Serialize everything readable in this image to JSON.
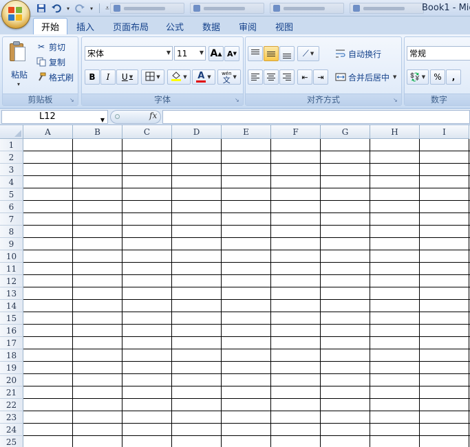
{
  "title_bar": {
    "window_title": "Book1 - Mic",
    "qat": {
      "save_icon": "save-icon",
      "undo_icon": "undo-icon",
      "redo_icon": "redo-icon",
      "customize_icon": "customize-qat-icon"
    }
  },
  "ribbon_tabs": [
    "开始",
    "插入",
    "页面布局",
    "公式",
    "数据",
    "审阅",
    "视图"
  ],
  "active_tab": "开始",
  "clipboard": {
    "group_label": "剪贴板",
    "paste_label": "粘贴",
    "cut_label": "剪切",
    "copy_label": "复制",
    "format_painter_label": "格式刷"
  },
  "font": {
    "group_label": "字体",
    "font_name": "宋体",
    "font_size": "11",
    "grow_label": "A",
    "shrink_label": "A",
    "bold": "B",
    "italic": "I",
    "underline": "U",
    "font_color_letter": "A",
    "phonetic_top": "wén",
    "phonetic_bottom": "文",
    "fill_color": "#ffff00",
    "font_color": "#e00000"
  },
  "alignment": {
    "group_label": "对齐方式",
    "wrap_text_label": "自动换行",
    "merge_center_label": "合并后居中"
  },
  "number": {
    "group_label": "数字",
    "format_value": "常规",
    "percent_label": "%",
    "comma_label": ","
  },
  "formula_bar": {
    "name_box": "L12",
    "fx_label": "fx",
    "formula": ""
  },
  "grid": {
    "columns": [
      "A",
      "B",
      "C",
      "D",
      "E",
      "F",
      "G",
      "H",
      "I"
    ],
    "rows": [
      "1",
      "2",
      "3",
      "4",
      "5",
      "6",
      "7",
      "8",
      "9",
      "10",
      "11",
      "12",
      "13",
      "14",
      "15",
      "16",
      "17",
      "18",
      "19",
      "20",
      "21",
      "22",
      "23",
      "24",
      "25"
    ]
  }
}
